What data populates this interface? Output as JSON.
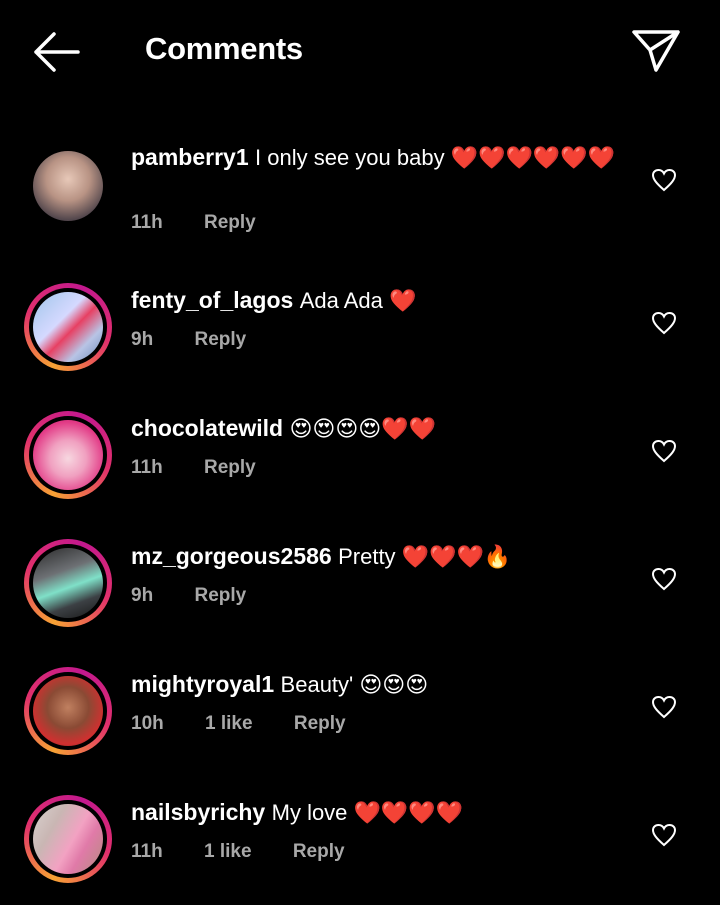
{
  "header": {
    "title": "Comments"
  },
  "comments": [
    {
      "user": "pamberry1",
      "text": "I only see you baby ❤️❤️❤️❤️❤️❤️",
      "time": "11h",
      "likes": "",
      "reply": "Reply"
    },
    {
      "user": "fenty_of_lagos",
      "text": "Ada Ada ❤️",
      "time": "9h",
      "likes": "",
      "reply": "Reply"
    },
    {
      "user": "chocolatewild",
      "text": "😍😍😍😍❤️❤️",
      "time": "11h",
      "likes": "",
      "reply": "Reply"
    },
    {
      "user": "mz_gorgeous2586",
      "text": "Pretty ❤️❤️❤️🔥",
      "time": "9h",
      "likes": "",
      "reply": "Reply"
    },
    {
      "user": "mightyroyal1",
      "text": "Beauty' 😍😍😍",
      "time": "10h",
      "likes": "1 like",
      "reply": "Reply"
    },
    {
      "user": "nailsbyrichy",
      "text": "My love ❤️❤️❤️❤️",
      "time": "11h",
      "likes": "1 like",
      "reply": "Reply"
    }
  ],
  "colors": {
    "background": "#000000",
    "meta": "#a8a8a8",
    "story_ring_start": "#f7a234",
    "story_ring_end": "#c2188e"
  },
  "icons": {
    "back": "arrow-left-icon",
    "share": "paper-plane-icon",
    "like": "heart-outline-icon"
  }
}
